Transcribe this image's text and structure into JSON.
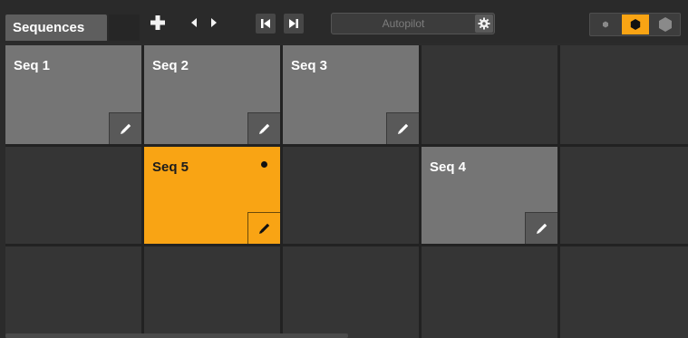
{
  "toolbar": {
    "tab_label": "Sequences",
    "add_label": "+",
    "autopilot_label": "Autopilot",
    "size_options": [
      "small",
      "medium",
      "large"
    ],
    "size_selected": "medium",
    "accent_color": "#f9a414"
  },
  "grid": {
    "columns": 5,
    "rows": 3,
    "cells": [
      {
        "title": "Seq 1",
        "state": "filled"
      },
      {
        "title": "Seq 2",
        "state": "filled"
      },
      {
        "title": "Seq 3",
        "state": "filled"
      },
      {
        "title": "",
        "state": "empty"
      },
      {
        "title": "",
        "state": "empty"
      },
      {
        "title": "",
        "state": "empty"
      },
      {
        "title": "Seq 5",
        "state": "active",
        "indicator": true
      },
      {
        "title": "",
        "state": "empty"
      },
      {
        "title": "Seq 4",
        "state": "filled"
      },
      {
        "title": "",
        "state": "empty"
      },
      {
        "title": "",
        "state": "empty"
      },
      {
        "title": "",
        "state": "empty"
      },
      {
        "title": "",
        "state": "empty"
      },
      {
        "title": "",
        "state": "empty"
      },
      {
        "title": "",
        "state": "empty"
      }
    ]
  }
}
